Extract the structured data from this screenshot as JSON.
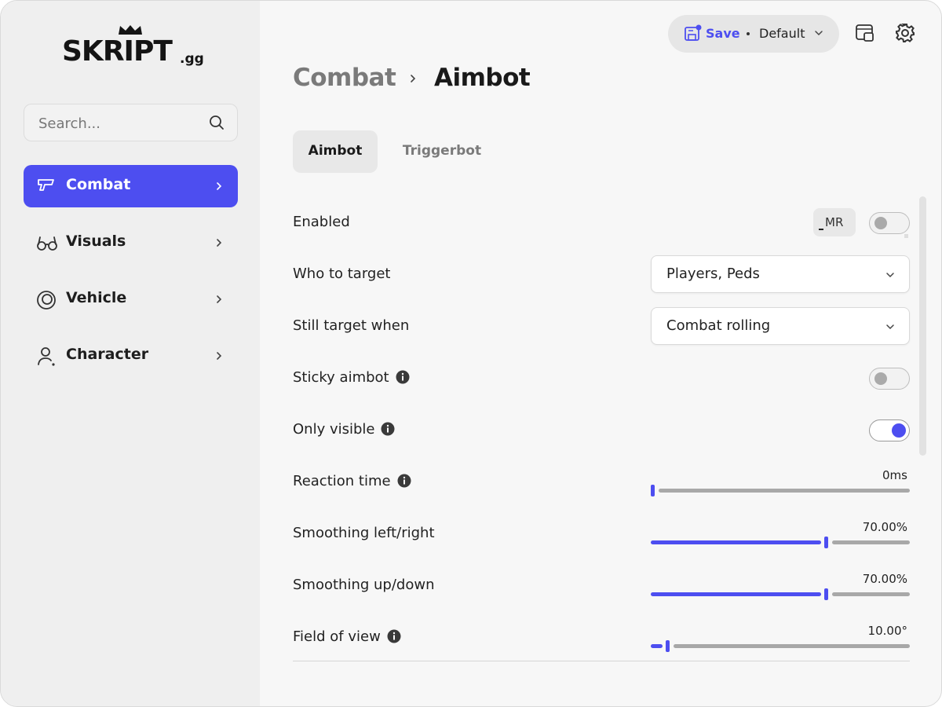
{
  "brand": {
    "name": "SKRIPT",
    "suffix": ".gg"
  },
  "search": {
    "placeholder": "Search..."
  },
  "sidebar": {
    "items": [
      {
        "label": "Combat",
        "icon": "gun-icon",
        "active": true
      },
      {
        "label": "Visuals",
        "icon": "glasses-icon",
        "active": false
      },
      {
        "label": "Vehicle",
        "icon": "wheel-icon",
        "active": false
      },
      {
        "label": "Character",
        "icon": "person-icon",
        "active": false
      }
    ]
  },
  "header": {
    "save_label": "Save",
    "profile_label": "Default",
    "window_icon": "window-icon",
    "settings_icon": "gear-icon"
  },
  "breadcrumb": {
    "parent": "Combat",
    "current": "Aimbot"
  },
  "tabs": [
    {
      "label": "Aimbot",
      "active": true
    },
    {
      "label": "Triggerbot",
      "active": false
    }
  ],
  "settings": {
    "enabled": {
      "label": "Enabled",
      "keybind": "MR",
      "value": false
    },
    "who_to_target": {
      "label": "Who to target",
      "value": "Players, Peds"
    },
    "still_target_when": {
      "label": "Still target when",
      "value": "Combat rolling"
    },
    "sticky_aimbot": {
      "label": "Sticky aimbot",
      "value": false
    },
    "only_visible": {
      "label": "Only visible",
      "value": true
    },
    "reaction_time": {
      "label": "Reaction time",
      "display": "0ms",
      "fraction": 0.0
    },
    "smoothing_lr": {
      "label": "Smoothing left/right",
      "display": "70.00%",
      "fraction": 0.7
    },
    "smoothing_ud": {
      "label": "Smoothing up/down",
      "display": "70.00%",
      "fraction": 0.7
    },
    "field_of_view": {
      "label": "Field of view",
      "display": "10.00°",
      "fraction": 0.06
    }
  },
  "colors": {
    "accent": "#4d4ef0",
    "sidebar_bg": "#efefef",
    "main_bg": "#f7f7f7"
  }
}
